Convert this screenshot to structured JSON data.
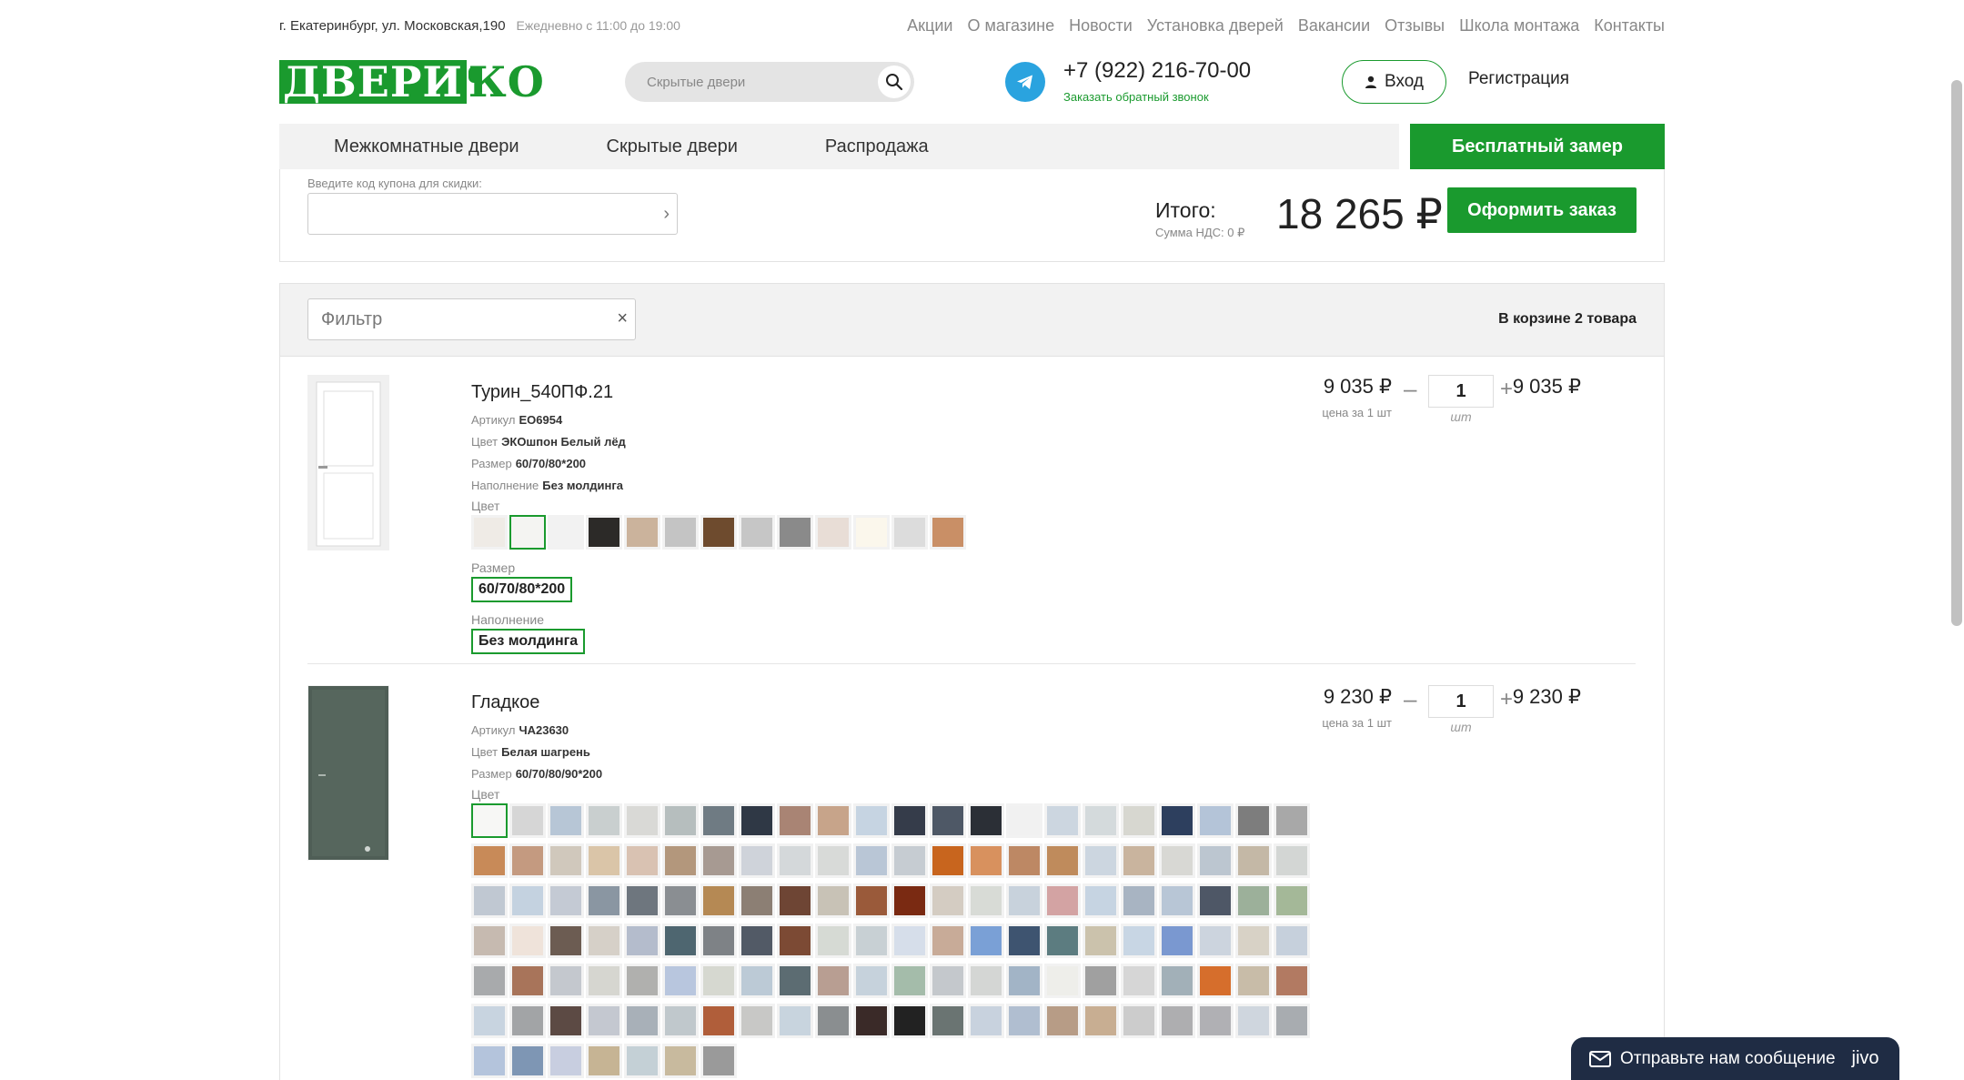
{
  "topbar": {
    "address": "г. Екатеринбург, ул. Московская,190",
    "hours": "Ежедневно с 11:00 до 19:00",
    "nav": [
      "Акции",
      "О магазине",
      "Новости",
      "Установка дверей",
      "Вакансии",
      "Отзывы",
      "Школа монтажа",
      "Контакты"
    ]
  },
  "header": {
    "logo_part1": "ДВЕРИ",
    "logo_part2": "КО",
    "search_placeholder": "Скрытые двери",
    "phone": "+7 (922) 216-70-00",
    "callback": "Заказать обратный звонок",
    "login": "Вход",
    "register": "Регистрация"
  },
  "menu": {
    "items": [
      "Межкомнатные двери",
      "Скрытые двери",
      "Распродажа"
    ],
    "cta": "Бесплатный замер"
  },
  "summary": {
    "coupon_label": "Введите код купона для скидки:",
    "total_label": "Итого:",
    "vat": "Сумма НДС: 0 ₽",
    "total": "18 265 ₽",
    "order_button": "Оформить заказ"
  },
  "cart": {
    "filter_placeholder": "Фильтр",
    "count_text": "В корзине 2 товара",
    "items": [
      {
        "name": "Турин_540ПФ.21",
        "article_label": "Артикул",
        "article": "ЕО6954",
        "color_label": "Цвет",
        "color": "ЭКОшпон Белый лёд",
        "size_label": "Размер",
        "size": "60/70/80*200",
        "fill_label": "Наполнение",
        "fill": "Без молдинга",
        "swatch_label": "Цвет",
        "size_select_label": "Размер",
        "size_option": "60/70/80*200",
        "fill_select_label": "Наполнение",
        "fill_option": "Без молдинга",
        "unit_price": "9 035 ₽",
        "unit_note": "цена за 1 шт",
        "qty": "1",
        "qty_unit": "шт",
        "sum": "9 035 ₽",
        "swatches": [
          "#efebe6",
          "#f4f4f2",
          "#f2f2f2",
          "#2c2a28",
          "#cbb39c",
          "#c4c4c4",
          "#6e4b2e",
          "#c6c6c6",
          "#8a8a8a",
          "#e8ddd6",
          "#fbf7ec",
          "#dcdcdc",
          "#c98f66"
        ]
      },
      {
        "name": "Гладкое",
        "article_label": "Артикул",
        "article": "ЧА23630",
        "color_label": "Цвет",
        "color": "Белая шагрень",
        "size_label": "Размер",
        "size": "60/70/80/90*200",
        "swatch_label": "Цвет",
        "unit_price": "9 230 ₽",
        "unit_note": "цена за 1 шт",
        "qty": "1",
        "qty_unit": "шт",
        "sum": "9 230 ₽",
        "swatches": [
          "#f7f7f5",
          "#d6d6d6",
          "#b7c6d6",
          "#c9cfcf",
          "#d9d9d6",
          "#b6bebe",
          "#6f7b83",
          "#2f3845",
          "#a98474",
          "#c7a48a",
          "#c6d4e2",
          "#353c4a",
          "#4e5866",
          "#2b2f36",
          "#f1f1f1",
          "#ccd6e0",
          "#d4dadc",
          "#d7d7d0",
          "#2d3f5e",
          "#b4c4d8",
          "#7d7d7d",
          "#a8a8a8",
          "#c88a58",
          "#c49a80",
          "#d0c8bc",
          "#dac5a8",
          "#d9c2b2",
          "#b3977c",
          "#a79a92",
          "#cfd3da",
          "#d4d8da",
          "#d8dad8",
          "#b9c6d6",
          "#c6ccd2",
          "#c8651e",
          "#d8915e",
          "#bd8864",
          "#bf8b5c",
          "#ccd6e0",
          "#c9b49e",
          "#d8d8d4",
          "#bcc6d0",
          "#c4b8a6",
          "#d3d6d4",
          "#c0c8d2",
          "#c4d2e0",
          "#c4cad4",
          "#8a96a2",
          "#6e767e",
          "#8a8e92",
          "#b58954",
          "#8c7f74",
          "#6e4534",
          "#c8c2b6",
          "#9a5a3a",
          "#7a2a12",
          "#d4ccc2",
          "#d8dbd6",
          "#c8d2dc",
          "#d3a3a3",
          "#c6d4e2",
          "#a8b4c2",
          "#b8c6d6",
          "#4e5766",
          "#9cb09a",
          "#a4b898",
          "#c6bab0",
          "#efe3da",
          "#6c5c52",
          "#d6d0c8",
          "#b4bccc",
          "#4e6670",
          "#7e8286",
          "#525a66",
          "#7c4a34",
          "#d6dad4",
          "#c8d0d4",
          "#d6deea",
          "#c8ab98",
          "#7aa0d6",
          "#3e5470",
          "#5c7c80",
          "#cbc2ac",
          "#c8d6e4",
          "#7a98d0",
          "#ccd4de",
          "#d8d2c6",
          "#c6d0dc",
          "#a8aaac",
          "#a8745a",
          "#c4c8ce",
          "#d6d6d0",
          "#b0b0ae",
          "#b8c6de",
          "#d6d8d0",
          "#bccad6",
          "#5c6c72",
          "#b89e92",
          "#c6d2dc",
          "#a4bcaa",
          "#c4c8cc",
          "#d4d6d4",
          "#a2b4c6",
          "#eeeeea",
          "#a0a0a0",
          "#d6d6d6",
          "#a2b0b8",
          "#d66e2c",
          "#c8bca8",
          "#b27a62",
          "#c8d4e0",
          "#a2a4a6",
          "#5c4a44",
          "#c4c8d0",
          "#a8b0b8",
          "#c0c8cc",
          "#b05e3a",
          "#c8c8c6",
          "#c8d4de",
          "#8a8e90",
          "#3a2a28",
          "#222222",
          "#6a7472",
          "#c8d2de",
          "#b0bed0",
          "#b79c86",
          "#c8ae92",
          "#cccccc",
          "#aeaeb0",
          "#b0b0b4",
          "#cfd6de",
          "#a8acb0",
          "#b4c4dc",
          "#7e96b4",
          "#c8cee0",
          "#c6b494",
          "#c4d0d6",
          "#c8ba9e",
          "#9a9a9a"
        ]
      }
    ]
  },
  "chat": {
    "text": "Отправьте нам сообщение",
    "brand": "jivo"
  }
}
